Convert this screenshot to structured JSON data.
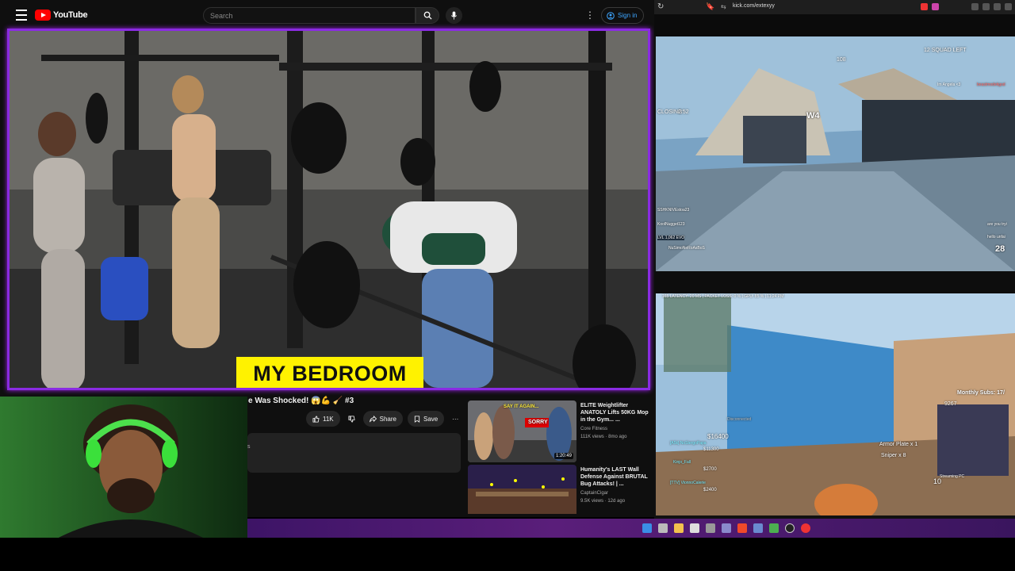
{
  "youtube": {
    "logo_text": "YouTube",
    "search_placeholder": "Search",
    "more_icon": "⋮",
    "signin_label": "Sign in",
    "caption_overlay": "MY BEDROOM",
    "video_title": "e Was Shocked! 😱💪 🧹 #3",
    "actions": {
      "likes": "11K",
      "share": "Share",
      "save": "Save",
      "more": "···"
    },
    "desc_dot": "s",
    "recommendations": [
      {
        "title": "ELITE Weightlifter ANATOLY Lifts 50KG Mop in the Gym... ...",
        "channel": "Core Fitness",
        "meta": "111K views · 8mo ago",
        "duration": "1:20:49",
        "thumb_text_top": "SAY IT AGAIN...",
        "thumb_text_mid": "SORRY"
      },
      {
        "title": "Humanity's LAST Wall Defense Against BRUTAL Bug Attacks! | ...",
        "channel": "CaptainCigar",
        "meta": "9.5K views · 12d ago",
        "duration": ""
      }
    ]
  },
  "browser": {
    "url": "kick.com/extexyy",
    "reload_icon": "↻",
    "bookmark_icon": "🔖",
    "url_icon": "⇆"
  },
  "game1": {
    "squads_left": "12 SQUAD LEFT",
    "compass": "108",
    "closing": "CLOSING",
    "closing_time": "2:52",
    "building_label": "W4",
    "killfeed_1": "Im Angela <3",
    "killfeed_2": "beastmodetigod",
    "squad_1": "SSHKNIVEstoa23",
    "squad_2": "KoolNugget123",
    "player_level": "LVL 1,062 EVO",
    "player_name": "NuSimoNeRoAsBoS",
    "ammo": "28",
    "chat_1": "are you tryi",
    "chat_2": "hello unfai"
  },
  "game2": {
    "stats_bar": "165 LATENCY: 20 MS | PACKET LOSS: 0 % | GPU: 85 % | 11:24 PM",
    "monthly_subs": "Monthly Subs: 17/",
    "money_total": "$16400",
    "disconnected": "Disconnected",
    "teammate_1": "[A5k] NoStergoPapa",
    "teammate_1_money": "$11300",
    "teammate_2": "Kinjo_Fall",
    "teammate_2_money": "$2700",
    "teammate_3": "[TTV] VionnoCalerie",
    "teammate_3_money": "$2400",
    "armor_text": "Armor Plate x 1",
    "sniper_text": "Sniper x 8",
    "credits": "9267",
    "ammo": "10",
    "cam_label": "Streaming PC"
  },
  "colors": {
    "player_border": "#8a2be2",
    "caption_bg": "#fff200",
    "taskbar": "#4a1a6e",
    "link_blue": "#3ea6ff"
  }
}
